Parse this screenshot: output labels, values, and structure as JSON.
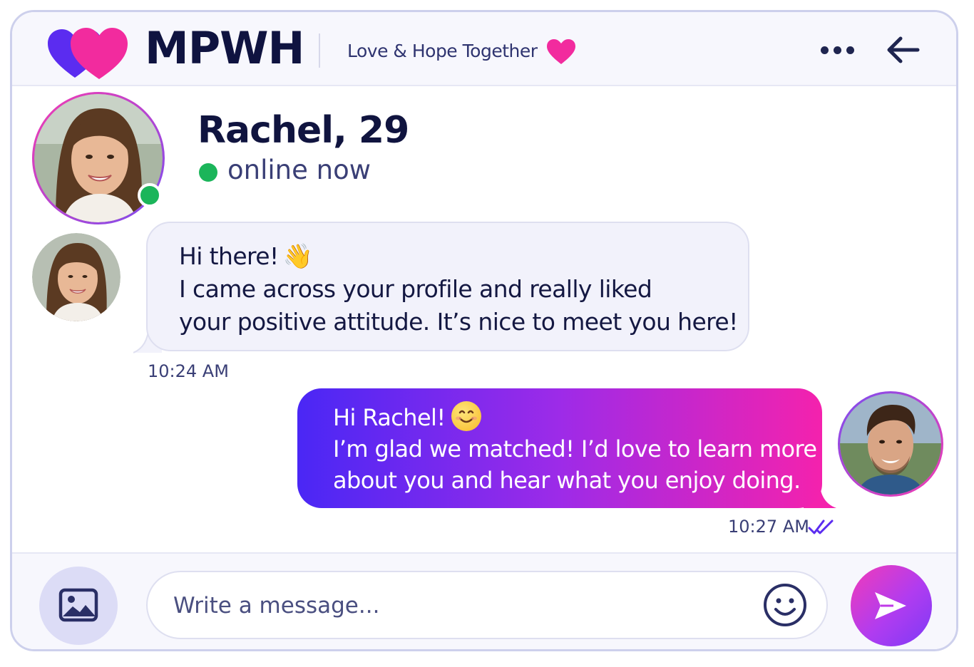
{
  "header": {
    "brand": "MPWH",
    "tagline": "Love & Hope Together"
  },
  "profile": {
    "name": "Rachel, 29",
    "status": "online now"
  },
  "messages": [
    {
      "direction": "incoming",
      "lines": [
        "Hi there!",
        "I came across your profile and really liked",
        "your positive attitude. It’s nice to meet you here!"
      ],
      "emoji": "👋",
      "time": "10:24 AM"
    },
    {
      "direction": "outgoing",
      "lines": [
        "Hi Rachel!",
        "I’m glad we matched! I’d love to learn more",
        "about you and hear what you enjoy doing."
      ],
      "emoji": "smile",
      "time": "10:27 AM",
      "read": true
    }
  ],
  "composer": {
    "placeholder": "Write a message..."
  },
  "colors": {
    "brand_pink": "#f22b9e",
    "brand_purple": "#5b2cf0",
    "online_green": "#1bb55a",
    "gradient_start": "#4a27f5",
    "gradient_end": "#f422ad"
  },
  "icons": [
    "hearts-logo-icon",
    "heart-icon",
    "more-icon",
    "back-arrow-icon",
    "image-icon",
    "emoji-icon",
    "send-icon",
    "double-check-icon"
  ]
}
